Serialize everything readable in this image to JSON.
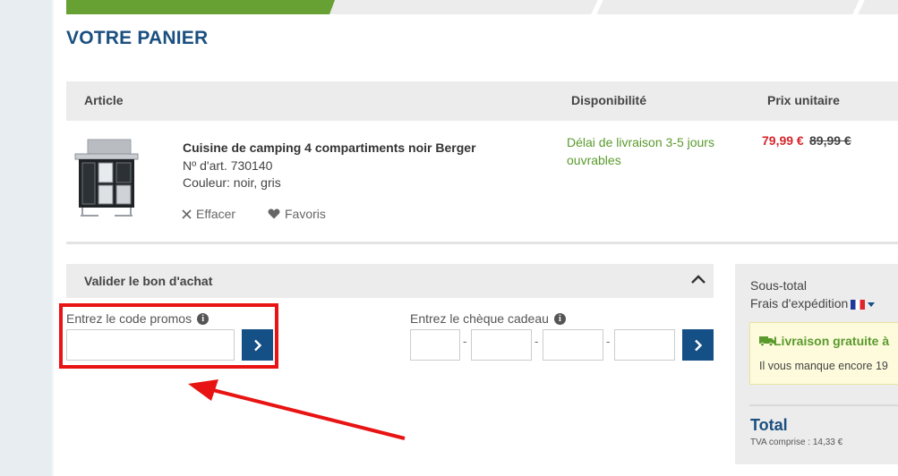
{
  "page": {
    "title": "VOTRE PANIER"
  },
  "table": {
    "headers": {
      "article": "Article",
      "availability": "Disponibilité",
      "unit_price": "Prix unitaire"
    }
  },
  "product": {
    "name": "Cuisine de camping 4 compartiments noir Berger",
    "article_number": "Nº d'art. 730140",
    "color": "Couleur: noir, gris",
    "remove_label": "Effacer",
    "favorite_label": "Favoris",
    "availability": "Délai de livraison 3-5 jours ouvrables",
    "price": "79,99 €",
    "old_price": "89,99 €"
  },
  "voucher": {
    "title": "Valider le bon d'achat",
    "promo_label": "Entrez le code promos",
    "promo_value": "",
    "gift_label": "Entrez le chèque cadeau",
    "gift_values": [
      "",
      "",
      "",
      ""
    ],
    "separator": "-"
  },
  "summary": {
    "subtotal_label": "Sous-total",
    "shipping_label": "Frais d'expédition",
    "free_shipping": "Livraison gratuite à",
    "remaining": "Il vous manque encore 19",
    "total_label": "Total",
    "vat": "TVA comprise : 14,33 €"
  },
  "colors": {
    "brand_blue": "#144f85",
    "green": "#67a033",
    "price_red": "#d6262b",
    "highlight_red": "#e81313"
  },
  "icons": [
    "info-icon",
    "close-icon",
    "heart-icon",
    "chevron-up-icon",
    "chevron-right-icon",
    "truck-icon",
    "france-flag-icon",
    "caret-down-icon"
  ]
}
